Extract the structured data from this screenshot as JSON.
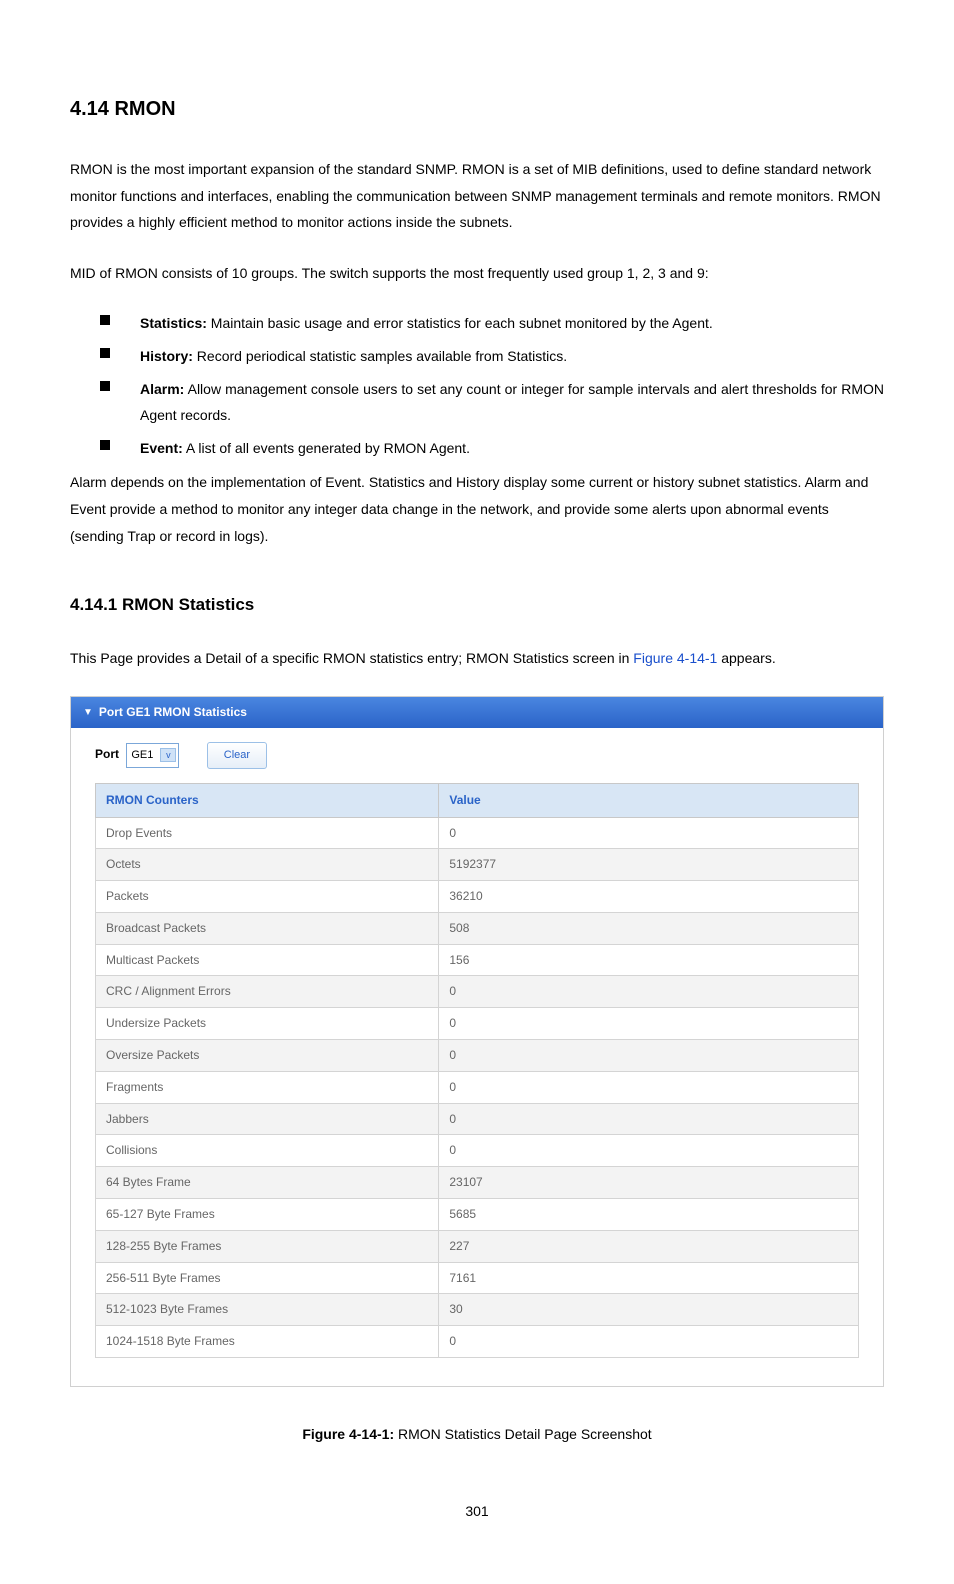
{
  "section": {
    "title": "4.14 RMON",
    "para1": "RMON is the most important expansion of the standard SNMP. RMON is a set of MIB definitions, used to define standard network monitor functions and interfaces, enabling the communication between SNMP management terminals and remote monitors. RMON provides a highly efficient method to monitor actions inside the subnets.",
    "para2": "MID of RMON consists of 10 groups. The switch supports the most frequently used group 1, 2, 3 and 9:",
    "bullets": [
      {
        "label": "Statistics:",
        "text": " Maintain basic usage and error statistics for each subnet monitored by the Agent."
      },
      {
        "label": "History:",
        "text": " Record periodical statistic samples available from Statistics."
      },
      {
        "label": "Alarm:",
        "text": " Allow management console users to set any count or integer for sample intervals and alert thresholds for RMON Agent records."
      },
      {
        "label": "Event:",
        "text": " A list of all events generated by RMON Agent."
      }
    ],
    "para3": "Alarm depends on the implementation of Event. Statistics and History display some current or history subnet statistics. Alarm and Event provide a method to monitor any integer data change in the network, and provide some alerts upon abnormal events (sending Trap or record in logs)."
  },
  "subsection": {
    "title": "4.14.1 RMON Statistics",
    "intro_pre": "This Page provides a Detail of a specific RMON statistics entry; RMON Statistics screen in ",
    "intro_ref": "Figure 4-14-1",
    "intro_post": " appears."
  },
  "panel": {
    "header": "Port GE1 RMON Statistics",
    "port_label": "Port",
    "port_value": "GE1",
    "clear_label": "Clear",
    "col_counter": "RMON Counters",
    "col_value": "Value",
    "rows": [
      {
        "name": "Drop Events",
        "value": "0"
      },
      {
        "name": "Octets",
        "value": "5192377"
      },
      {
        "name": "Packets",
        "value": "36210"
      },
      {
        "name": "Broadcast Packets",
        "value": "508"
      },
      {
        "name": "Multicast Packets",
        "value": "156"
      },
      {
        "name": "CRC / Alignment Errors",
        "value": "0"
      },
      {
        "name": "Undersize Packets",
        "value": "0"
      },
      {
        "name": "Oversize Packets",
        "value": "0"
      },
      {
        "name": "Fragments",
        "value": "0"
      },
      {
        "name": "Jabbers",
        "value": "0"
      },
      {
        "name": "Collisions",
        "value": "0"
      },
      {
        "name": "64 Bytes Frame",
        "value": "23107"
      },
      {
        "name": "65-127 Byte Frames",
        "value": "5685"
      },
      {
        "name": "128-255 Byte Frames",
        "value": "227"
      },
      {
        "name": "256-511 Byte Frames",
        "value": "7161"
      },
      {
        "name": "512-1023 Byte Frames",
        "value": "30"
      },
      {
        "name": "1024-1518 Byte Frames",
        "value": "0"
      }
    ]
  },
  "figure": {
    "label": "Figure 4-14-1:",
    "caption": " RMON Statistics Detail Page Screenshot"
  },
  "pagenum": "301"
}
